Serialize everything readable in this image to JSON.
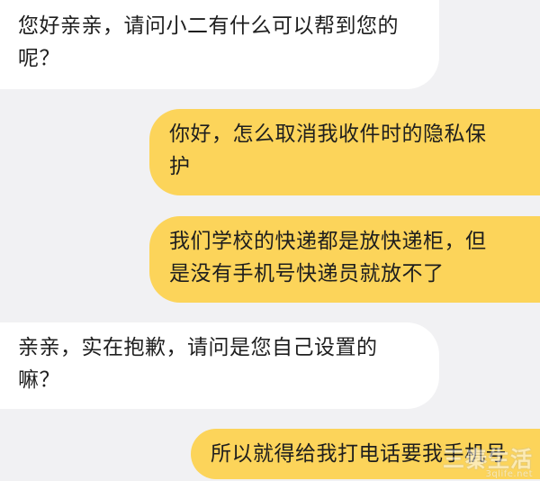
{
  "conversation": {
    "messages": [
      {
        "sender": "客服",
        "lines": [
          "您好亲亲，请问小二有什么可以帮到您的",
          "呢？"
        ]
      },
      {
        "sender": "用户",
        "lines": [
          "你好，怎么取消我收件时的隐私保",
          "护"
        ]
      },
      {
        "sender": "用户",
        "lines": [
          "我们学校的快递都是放快递柜，但",
          "是没有手机号快递员就放不了"
        ]
      },
      {
        "sender": "客服",
        "lines": [
          "亲亲，实在抱歉，请问是您自己设置的",
          "嘛？"
        ]
      },
      {
        "sender": "用户",
        "lines": [
          "所以就得给我打电话要我手机号"
        ]
      }
    ]
  },
  "watermark": {
    "main": "三秦生活",
    "sub": "3qlife.net"
  },
  "colors": {
    "background": "#f1f1f3",
    "received_bubble": "#ffffff",
    "sent_bubble": "#fcd45a",
    "text": "#1e1e1e"
  }
}
